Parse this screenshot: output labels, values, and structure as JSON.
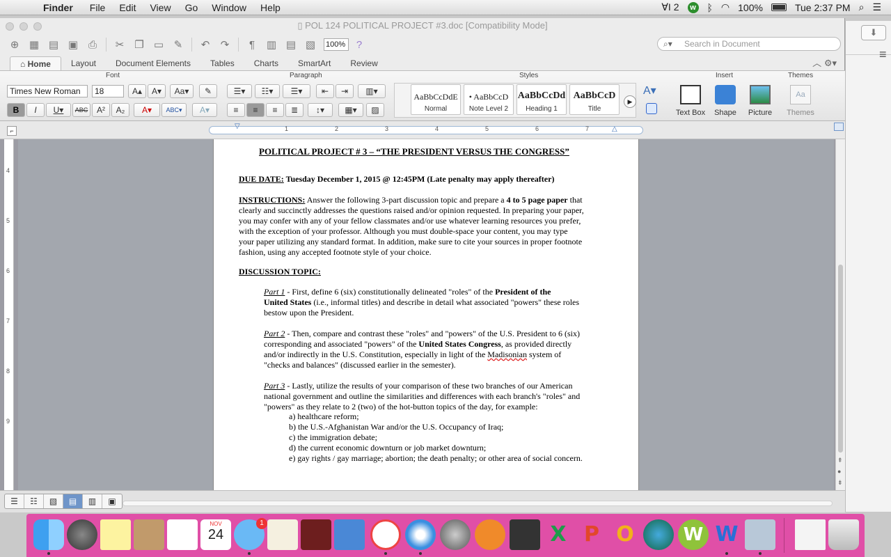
{
  "menubar": {
    "app": "Finder",
    "items": [
      "File",
      "Edit",
      "View",
      "Go",
      "Window",
      "Help"
    ],
    "adobe_count": "2",
    "battery": "100%",
    "clock": "Tue 2:37 PM"
  },
  "window": {
    "title": "POL 124 POLITICAL PROJECT #3.doc [Compatibility Mode]",
    "zoom": "100%",
    "search_placeholder": "Search in Document"
  },
  "tabs": [
    "Home",
    "Layout",
    "Document Elements",
    "Tables",
    "Charts",
    "SmartArt",
    "Review"
  ],
  "ribbon": {
    "groups": {
      "font": "Font",
      "paragraph": "Paragraph",
      "styles": "Styles",
      "insert": "Insert",
      "themes": "Themes"
    },
    "font_name": "Times New Roman",
    "font_size": "18",
    "styles": [
      {
        "sample": "AaBbCcDdE",
        "label": "Normal"
      },
      {
        "sample": "• AaBbCcD",
        "label": "Note Level 2"
      },
      {
        "sample": "AaBbCcDd",
        "label": "Heading 1"
      },
      {
        "sample": "AaBbCcD",
        "label": "Title"
      }
    ],
    "insert": [
      "Text Box",
      "Shape",
      "Picture"
    ],
    "themes_label": "Themes",
    "themes_icon_text": "Aa"
  },
  "ruler": {
    "numbers": [
      "1",
      "2",
      "3",
      "4",
      "5",
      "6",
      "7"
    ],
    "vertical": [
      "4",
      "5",
      "6",
      "7",
      "8",
      "9"
    ]
  },
  "document": {
    "title": "POLITICAL PROJECT # 3 – “THE PRESIDENT VERSUS THE CONGRESS”",
    "due_label": "DUE DATE:",
    "due_text": "  Tuesday December 1, 2015 @ 12:45PM (Late penalty may apply thereafter)",
    "instructions_label": "INSTRUCTIONS:",
    "instructions_l1a": "  Answer the following 3-part discussion topic and prepare a ",
    "instructions_l1b": "4 to 5 page paper",
    "instructions_l1c": " that",
    "instructions_lines": [
      "clearly and succinctly addresses the questions raised and/or opinion requested. In preparing your paper,",
      "you may confer with any of your fellow classmates and/or use whatever learning resources you prefer,",
      "with the exception of your professor. Although you must double-space your content, you may type",
      "your paper utilizing any standard format. In addition, make sure to cite your sources in proper footnote",
      "fashion, using any accepted footnote style of your choice."
    ],
    "topic_label": "DISCUSSION TOPIC:",
    "part1_label": "Part 1",
    "part1_l1a": " -  First, define 6 (six) constitutionally delineated \"roles\" of the ",
    "part1_l1b": "President of the",
    "part1_l2a": "United States",
    "part1_l2b": " (i.e., informal titles) and describe in detail what associated \"powers\" these  roles",
    "part1_l3": "bestow upon the President.",
    "part2_label": "Part 2",
    "part2_l1": " - Then, compare and contrast these \"roles\" and \"powers\" of the U.S. President to 6 (six)",
    "part2_l2a": "corresponding and associated \"powers\" of the ",
    "part2_l2b": "United States Congress",
    "part2_l2c": ", as provided directly",
    "part2_l3a": "and/or indirectly in the U.S. Constitution, especially in light of the ",
    "part2_l3b": "Madisonian",
    "part2_l3c": " system of",
    "part2_l4": "\"checks and balances\" (discussed earlier in the semester).",
    "part3_label": "Part 3",
    "part3_l1": " - Lastly, utilize the results of your comparison of these two branches of our American",
    "part3_l2": "national government and outline the similarities and differences with each branch's \"roles\" and",
    "part3_l3": "\"powers\" as they relate to 2 (two) of the hot-button topics of the day, for example:",
    "examples": [
      "a) healthcare reform;",
      "b) the U.S.-Afghanistan War and/or the U.S. Occupancy of Iraq;",
      "c) the immigration debate;",
      "d) the current economic downturn or job market downturn;",
      "e) gay rights / gay marriage; abortion; the death penalty; or other area of social concern."
    ]
  },
  "dock": {
    "calendar_month": "NOV",
    "calendar_day": "24",
    "messages_badge": "1",
    "letters": {
      "excel": "X",
      "powerpoint": "P",
      "outlook": "O",
      "wps": "W",
      "word": "W"
    }
  }
}
